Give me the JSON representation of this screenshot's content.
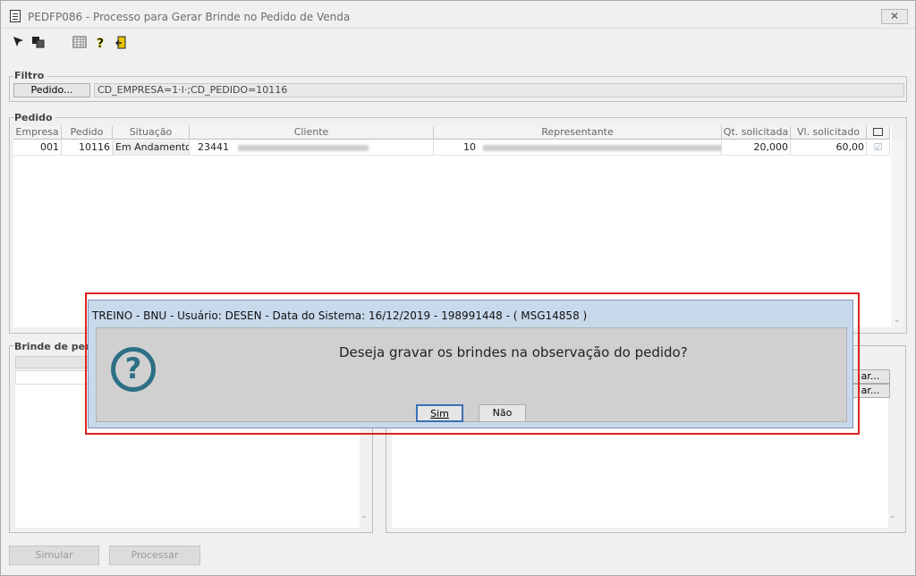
{
  "window": {
    "title": "PEDFP086 - Processo para Gerar Brinde no Pedido de Venda",
    "close_glyph": "✕"
  },
  "toolbar": {
    "icons": [
      "cursor-icon",
      "copy-icon",
      "calendar-icon",
      "help-icon",
      "exit-icon"
    ]
  },
  "filtro": {
    "label": "Filtro",
    "button_label": "Pedido...",
    "value": "CD_EMPRESA=1·l·;CD_PEDIDO=10116"
  },
  "pedido": {
    "label": "Pedido",
    "columns": [
      "Empresa",
      "Pedido",
      "Situação",
      "Cliente",
      "Representante",
      "Qt. solicitada",
      "Vl. solicitado"
    ],
    "rows": [
      {
        "empresa": "001",
        "pedido": "10116",
        "situacao": "Em Andamento",
        "cliente_code": "23441",
        "representante_code": "10",
        "qt_solicitada": "20,000",
        "vl_solicitado": "60,00",
        "checked": true
      }
    ]
  },
  "brinde": {
    "label": "Brinde de pedi",
    "btn1": "ar...",
    "btn2": "ar..."
  },
  "dialog": {
    "title": "TREINO - BNU - Usuário: DESEN - Data do Sistema: 16/12/2019 - 198991448 - ( MSG14858 )",
    "message": "Deseja gravar os brindes na observação do pedido?",
    "yes_label": "Sim",
    "no_label": "Não",
    "icon": "question-icon"
  },
  "footer": {
    "simular_label": "Simular",
    "processar_label": "Processar"
  },
  "colors": {
    "highlight_border": "#dd2222",
    "dialog_title_bg": "#c9d9ec",
    "icon_color": "#2d6f86"
  }
}
